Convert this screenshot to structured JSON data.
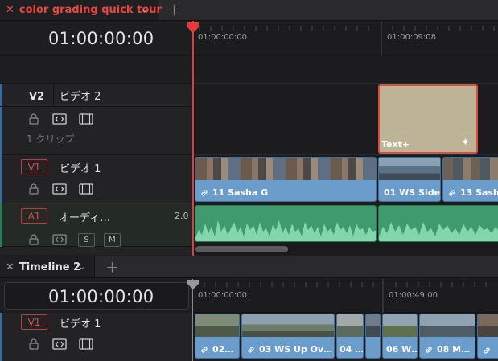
{
  "top_tab": {
    "title": "color grading quick tour"
  },
  "top_timeline": {
    "timecode": "01:00:00:00",
    "ruler": [
      "01:00:00:00",
      "01:00:09:08"
    ],
    "tracks": {
      "v2": {
        "id": "V2",
        "name": "ビデオ 2",
        "count": "1 クリップ"
      },
      "v1": {
        "id": "V1",
        "name": "ビデオ 1"
      },
      "a1": {
        "id": "A1",
        "name": "オーディ…",
        "format": "2.0",
        "solo": "S",
        "mute": "M"
      }
    },
    "title_clip": {
      "label": "Text+"
    },
    "clips": [
      "11 Sasha G",
      "01 WS Side…",
      "13 Sash"
    ]
  },
  "bottom_tab": {
    "title": "Timeline 2"
  },
  "bottom_timeline": {
    "timecode": "01:00:00:00",
    "ruler": [
      "01:00:00:00",
      "01:00:49:00"
    ],
    "track": {
      "id": "V1",
      "name": "ビデオ 1"
    },
    "clips": [
      "02…",
      "03 WS Up Ov…",
      "04 …",
      "06 W…",
      "08 M…"
    ]
  },
  "colors": {
    "accent": "#e33b3b",
    "video_clip": "#6a9ccc",
    "audio_clip": "#3f9a6e",
    "title_clip": "#bdb497"
  }
}
